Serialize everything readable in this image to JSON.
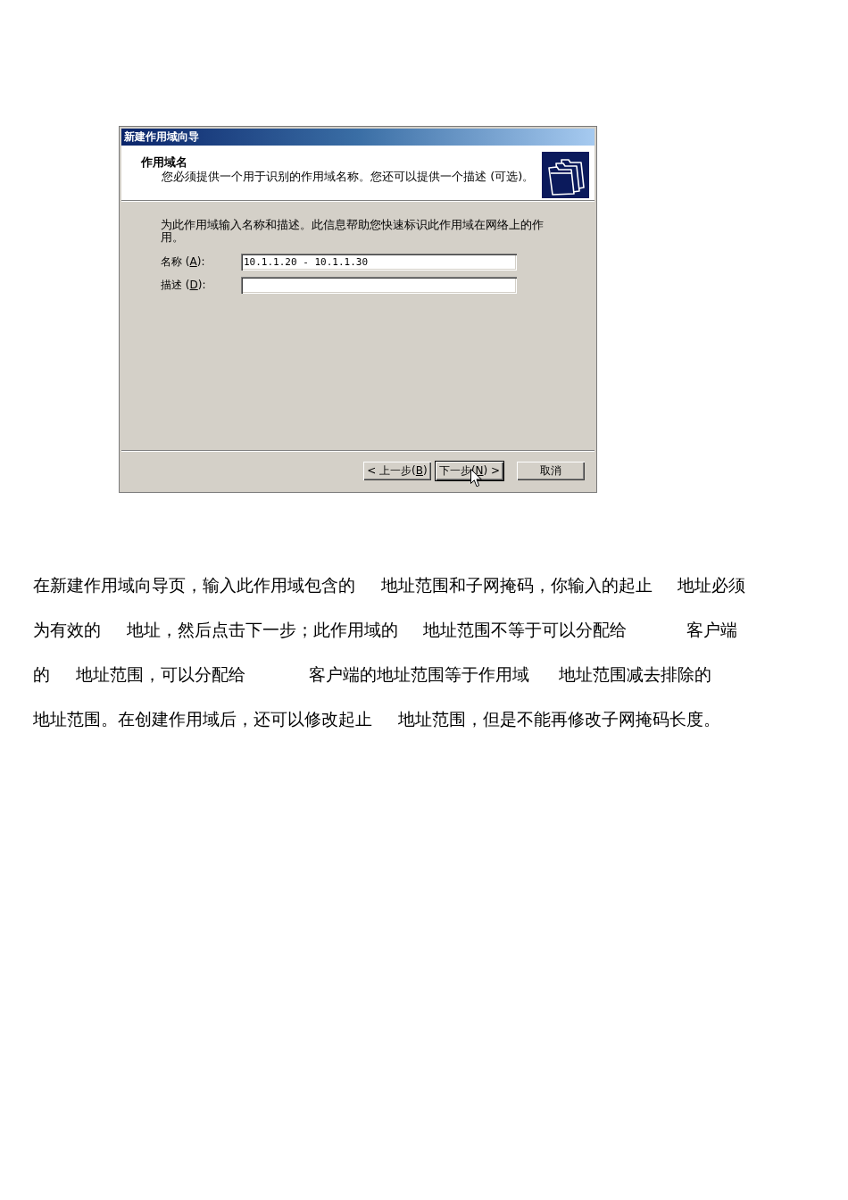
{
  "dialog": {
    "title": "新建作用域向导",
    "header": {
      "heading": "作用域名",
      "subtitle": "您必须提供一个用于识别的作用域名称。您还可以提供一个描述 (可选)。"
    },
    "instructions": "为此作用域输入名称和描述。此信息帮助您快速标识此作用域在网络上的作用。",
    "fields": [
      {
        "label_before": "名称 (",
        "access_key": "A",
        "label_after": "):",
        "value": "10.1.1.20 - 10.1.1.30"
      },
      {
        "label_before": "描述 (",
        "access_key": "D",
        "label_after": "):"
      }
    ],
    "buttons": [
      {
        "kind": "back",
        "text_before": "< 上一步(",
        "access_key": "B",
        "text_after": ")",
        "focused": false
      },
      {
        "kind": "next",
        "text_before": "下一步(",
        "access_key": "N",
        "text_after": ") >",
        "focused": true
      },
      {
        "kind": "cancel",
        "text": "取消",
        "focused": false
      }
    ]
  },
  "paragraph": {
    "lines": [
      "在新建作用域向导页，输入此作用域包含的      地址范围和子网掩码，你输入的起止      地址必须",
      "为有效的      地址，然后点击下一步；此作用域的      地址范围不等于可以分配给              客户端",
      "的      地址范围，可以分配给               客户端的地址范围等于作用域       地址范围减去排除的",
      "地址范围。在创建作用域后，还可以修改起止      地址范围，但是不能再修改子网掩码长度。"
    ]
  }
}
